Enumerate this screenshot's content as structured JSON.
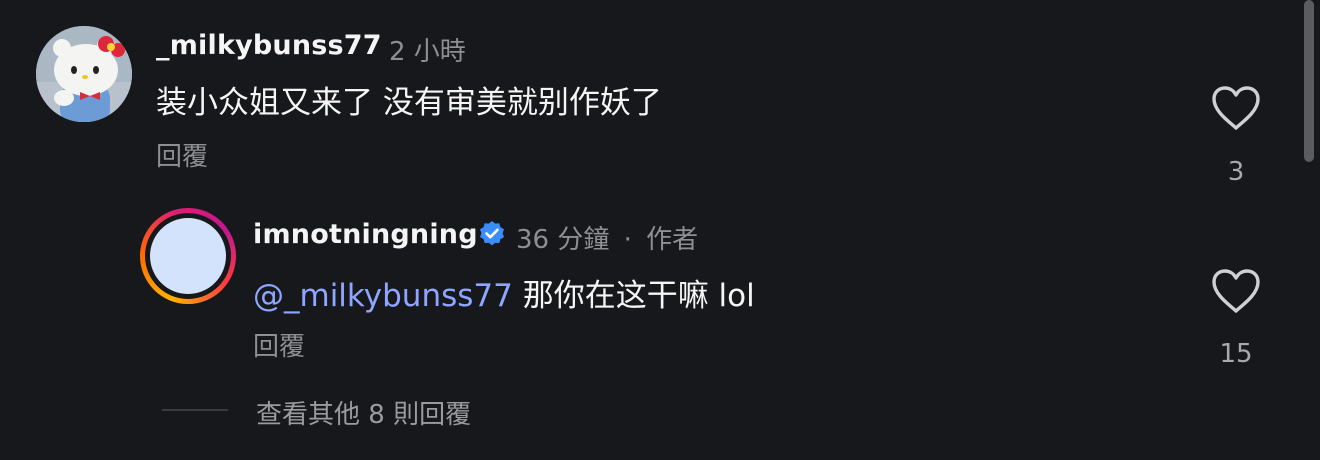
{
  "comments": [
    {
      "username": "_milkybunss77",
      "time": "2 小時",
      "text": "装小众姐又来了 没有审美就别作妖了",
      "reply_label": "回覆",
      "like_count": "3"
    }
  ],
  "reply_comment": {
    "username": "imnotningning",
    "time": "36 分鐘",
    "separator": "·",
    "author_badge": "作者",
    "mention": "@_milkybunss77",
    "text": " 那你在这干嘛 lol",
    "reply_label": "回覆",
    "like_count": "15"
  },
  "view_more": {
    "label": "查看其他 8 則回覆"
  },
  "colors": {
    "background": "#16181b",
    "mention": "#8ea6ff",
    "verified": "#3a8dff"
  },
  "icons": [
    "heart-icon",
    "verified-badge-icon"
  ]
}
